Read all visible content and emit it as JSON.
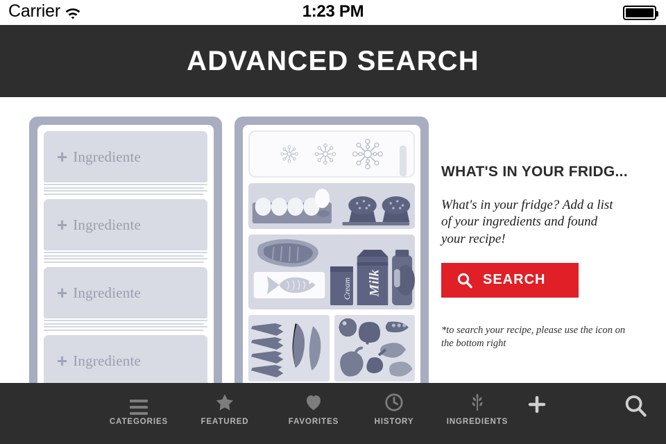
{
  "status_bar": {
    "carrier": "Carrier",
    "wifi_icon": "wifi-icon",
    "time": "1:23 PM",
    "battery_icon": "battery-full-icon"
  },
  "header": {
    "title": "ADVANCED SEARCH",
    "background_color": "#2e2e2e",
    "text_color": "#ffffff"
  },
  "fridge": {
    "frame_color": "#a8adc1",
    "slot_color": "#d8dae4",
    "door": {
      "slots": [
        {
          "plus": "+",
          "label": "Ingrediente"
        },
        {
          "plus": "+",
          "label": "Ingrediente"
        },
        {
          "plus": "+",
          "label": "Ingrediente"
        },
        {
          "plus": "+",
          "label": "Ingrediente"
        }
      ]
    },
    "cabinet": {
      "freezer_snowflakes": [
        "❇",
        "❇",
        "❇"
      ],
      "shelf_items": [
        "egg-carton",
        "muffins",
        "meat",
        "fish",
        "cream-jar",
        "milk-carton",
        "jug"
      ],
      "drawer_items": [
        "asparagus",
        "chili-peppers",
        "eggplant",
        "artichoke",
        "peas",
        "lemon",
        "bell-pepper"
      ],
      "labels": {
        "cream": "Cream",
        "milk": "Milk"
      }
    }
  },
  "info_panel": {
    "heading": "WHAT'S IN YOUR FRIDG...",
    "description": "What's in your fridge? Add a list of your ingredients and found your recipe!",
    "search_button": {
      "label": "SEARCH",
      "icon": "search-icon",
      "background_color": "#e01f26",
      "text_color": "#ffffff"
    },
    "footnote": "*to search your recipe, please use the icon on the bottom right"
  },
  "tab_bar": {
    "background_color": "#2e2e2e",
    "items": [
      {
        "label": "CATEGORIES",
        "icon": "hamburger-icon"
      },
      {
        "label": "FEATURED",
        "icon": "star-icon"
      },
      {
        "label": "FAVORITES",
        "icon": "heart-icon"
      },
      {
        "label": "HISTORY",
        "icon": "clock-icon"
      },
      {
        "label": "INGREDIENTS",
        "icon": "herb-sprig-icon"
      }
    ],
    "actions": [
      {
        "name": "add",
        "icon": "plus-icon"
      },
      {
        "name": "search",
        "icon": "search-icon"
      }
    ]
  }
}
